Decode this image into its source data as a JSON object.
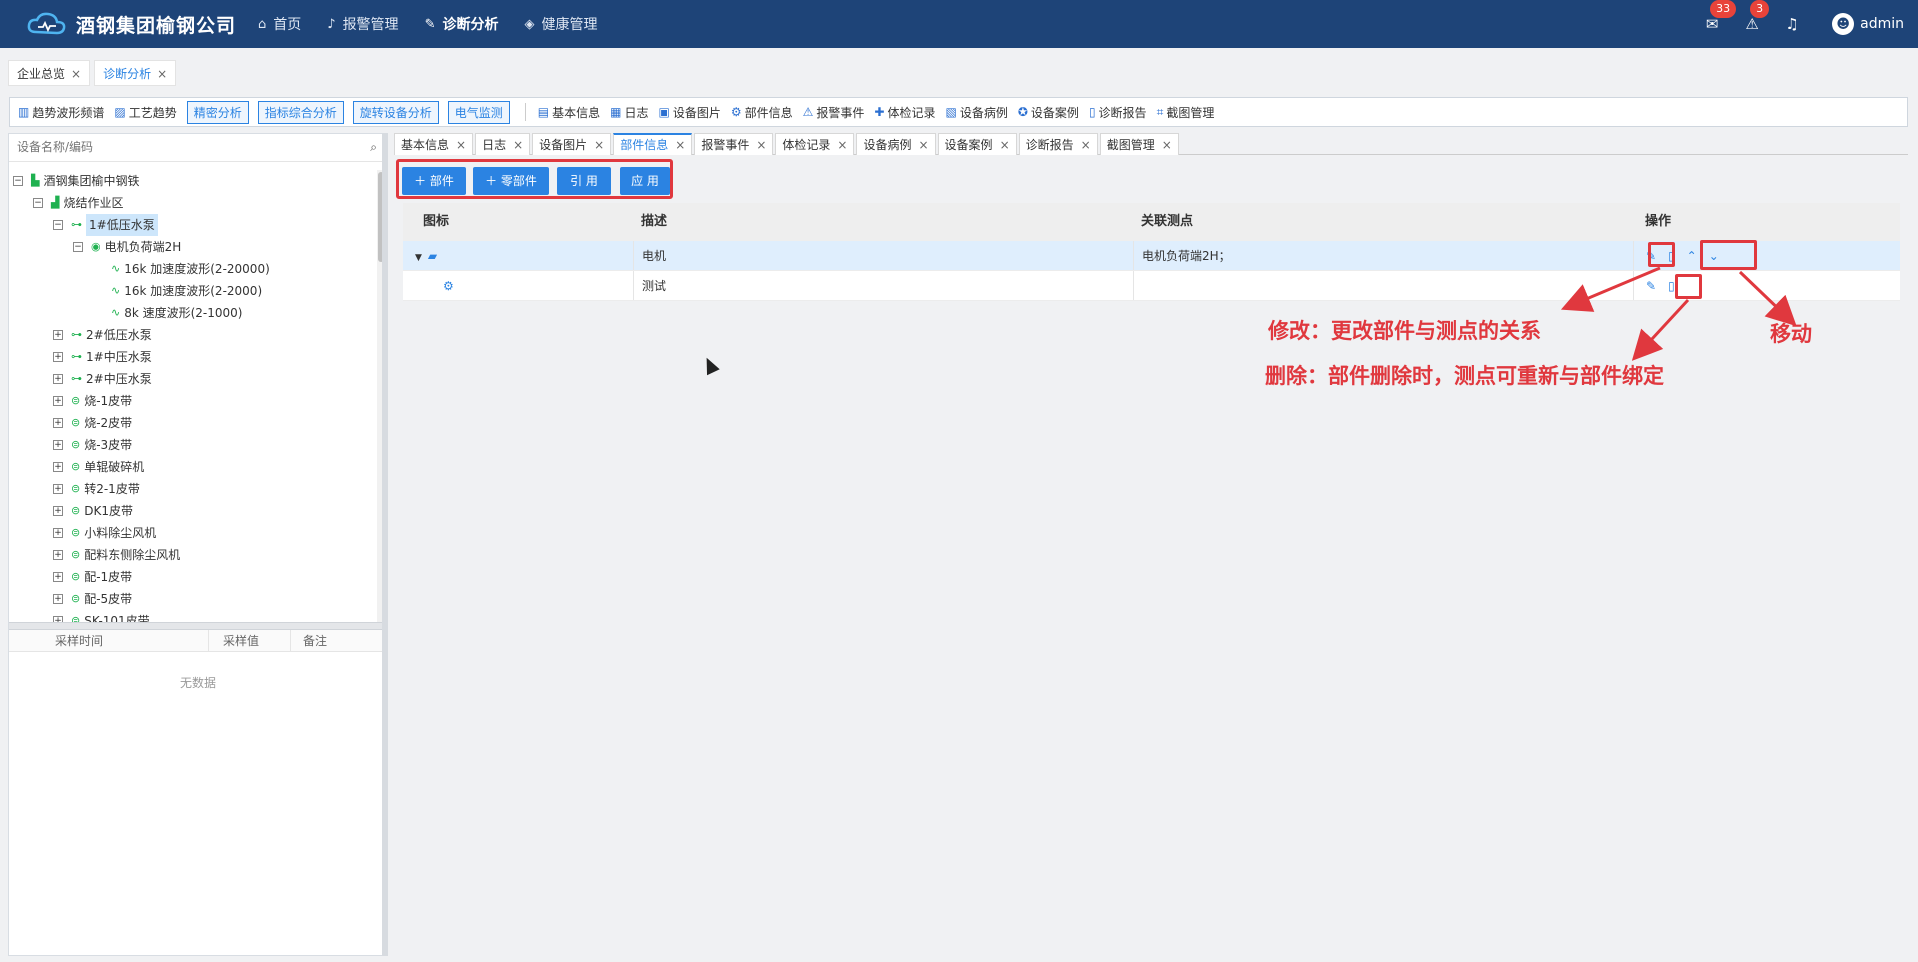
{
  "header": {
    "brand": "酒钢集团榆钢公司",
    "nav": [
      {
        "label": "首页",
        "icon": "home-icon"
      },
      {
        "label": "报警管理",
        "icon": "bell-icon"
      },
      {
        "label": "诊断分析",
        "icon": "wrench-icon"
      },
      {
        "label": "健康管理",
        "icon": "shield-icon"
      }
    ],
    "badges": {
      "messages": "33",
      "alerts": "3"
    },
    "user": "admin"
  },
  "page_tabs": [
    "企业总览",
    "诊断分析"
  ],
  "toolbar": {
    "items_left": [
      "趋势波形频谱",
      "工艺趋势"
    ],
    "buttons": [
      "精密分析",
      "指标综合分析",
      "旋转设备分析",
      "电气监测"
    ],
    "items_right": [
      "基本信息",
      "日志",
      "设备图片",
      "部件信息",
      "报警事件",
      "体检记录",
      "设备病例",
      "设备案例",
      "诊断报告",
      "截图管理"
    ]
  },
  "search": {
    "placeholder": "设备名称/编码"
  },
  "tree": [
    {
      "label": "酒钢集团榆中钢铁"
    },
    {
      "label": "烧结作业区"
    },
    {
      "label": "1#低压水泵"
    },
    {
      "label": "电机负荷端2H"
    },
    {
      "label": "16k 加速度波形(2-20000)"
    },
    {
      "label": "16k 加速度波形(2-2000)"
    },
    {
      "label": "8k 速度波形(2-1000)"
    },
    {
      "label": "2#低压水泵"
    },
    {
      "label": "1#中压水泵"
    },
    {
      "label": "2#中压水泵"
    },
    {
      "label": "烧-1皮带"
    },
    {
      "label": "烧-2皮带"
    },
    {
      "label": "烧-3皮带"
    },
    {
      "label": "单辊破碎机"
    },
    {
      "label": "转2-1皮带"
    },
    {
      "label": "DK1皮带"
    },
    {
      "label": "小料除尘风机"
    },
    {
      "label": "配料东侧除尘风机"
    },
    {
      "label": "配-1皮带"
    },
    {
      "label": "配-5皮带"
    },
    {
      "label": "SK-101皮带"
    }
  ],
  "sample_table": {
    "columns": [
      "采样时间",
      "采样值",
      "备注"
    ],
    "empty_text": "无数据"
  },
  "detail_tabs": [
    "基本信息",
    "日志",
    "设备图片",
    "部件信息",
    "报警事件",
    "体检记录",
    "设备病例",
    "设备案例",
    "诊断报告",
    "截图管理"
  ],
  "actions": [
    "＋ 部件",
    "＋ 零部件",
    "引 用",
    "应 用"
  ],
  "grid": {
    "columns": [
      "图标",
      "描述",
      "关联测点",
      "操作"
    ],
    "rows": [
      {
        "desc": "电机",
        "points": "电机负荷端2H；"
      },
      {
        "desc": "测试",
        "points": ""
      }
    ]
  },
  "annotations": {
    "edit": "修改：更改部件与测点的关系",
    "delete": "删除：部件删除时，测点可重新与部件绑定",
    "move": "移动"
  },
  "colors": {
    "header_bg": "#1e4478",
    "accent": "#2b83e2",
    "annotation": "#e0383e"
  }
}
